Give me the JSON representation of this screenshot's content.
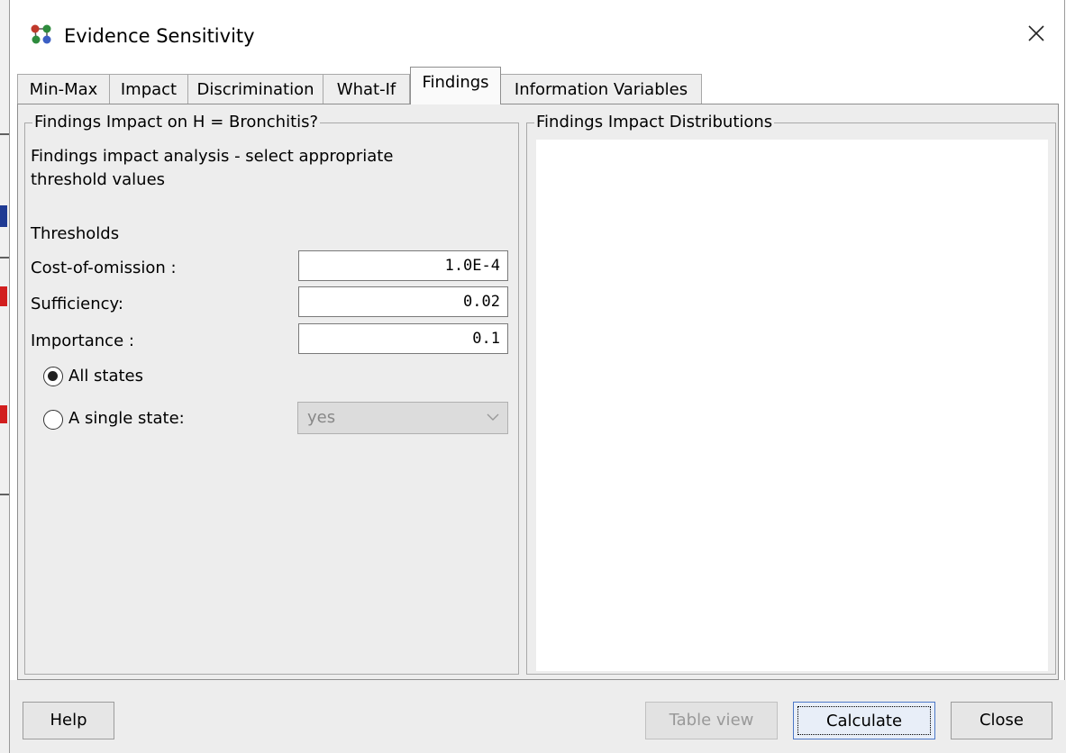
{
  "window": {
    "title": "Evidence Sensitivity",
    "icon": "network-nodes-icon",
    "close_icon": "close-icon"
  },
  "tabs": [
    {
      "label": "Min-Max",
      "active": false
    },
    {
      "label": "Impact",
      "active": false
    },
    {
      "label": "Discrimination",
      "active": false
    },
    {
      "label": "What-If",
      "active": false
    },
    {
      "label": "Findings",
      "active": true
    },
    {
      "label": "Information Variables",
      "active": false
    }
  ],
  "left_panel": {
    "title": "Findings Impact on H = Bronchitis?",
    "description_line1": "Findings impact analysis - select appropriate",
    "description_line2": "threshold values",
    "thresholds_heading": "Thresholds",
    "cost_of_omission_label": "Cost-of-omission :",
    "cost_of_omission_value": "1.0E-4",
    "sufficiency_label": "Sufficiency:",
    "sufficiency_value": "0.02",
    "importance_label": "Importance :",
    "importance_value": "0.1",
    "all_states_label": "All states",
    "all_states_selected": true,
    "single_state_label": "A single state:",
    "single_state_selected": false,
    "single_state_value": "yes",
    "single_state_enabled": false
  },
  "right_panel": {
    "title": "Findings Impact Distributions"
  },
  "buttons": {
    "help": "Help",
    "table_view": "Table view",
    "calculate": "Calculate",
    "close": "Close"
  },
  "colors": {
    "panel_bg": "#ededed",
    "focus_border": "#4d78c7",
    "disabled_text": "#999999"
  }
}
